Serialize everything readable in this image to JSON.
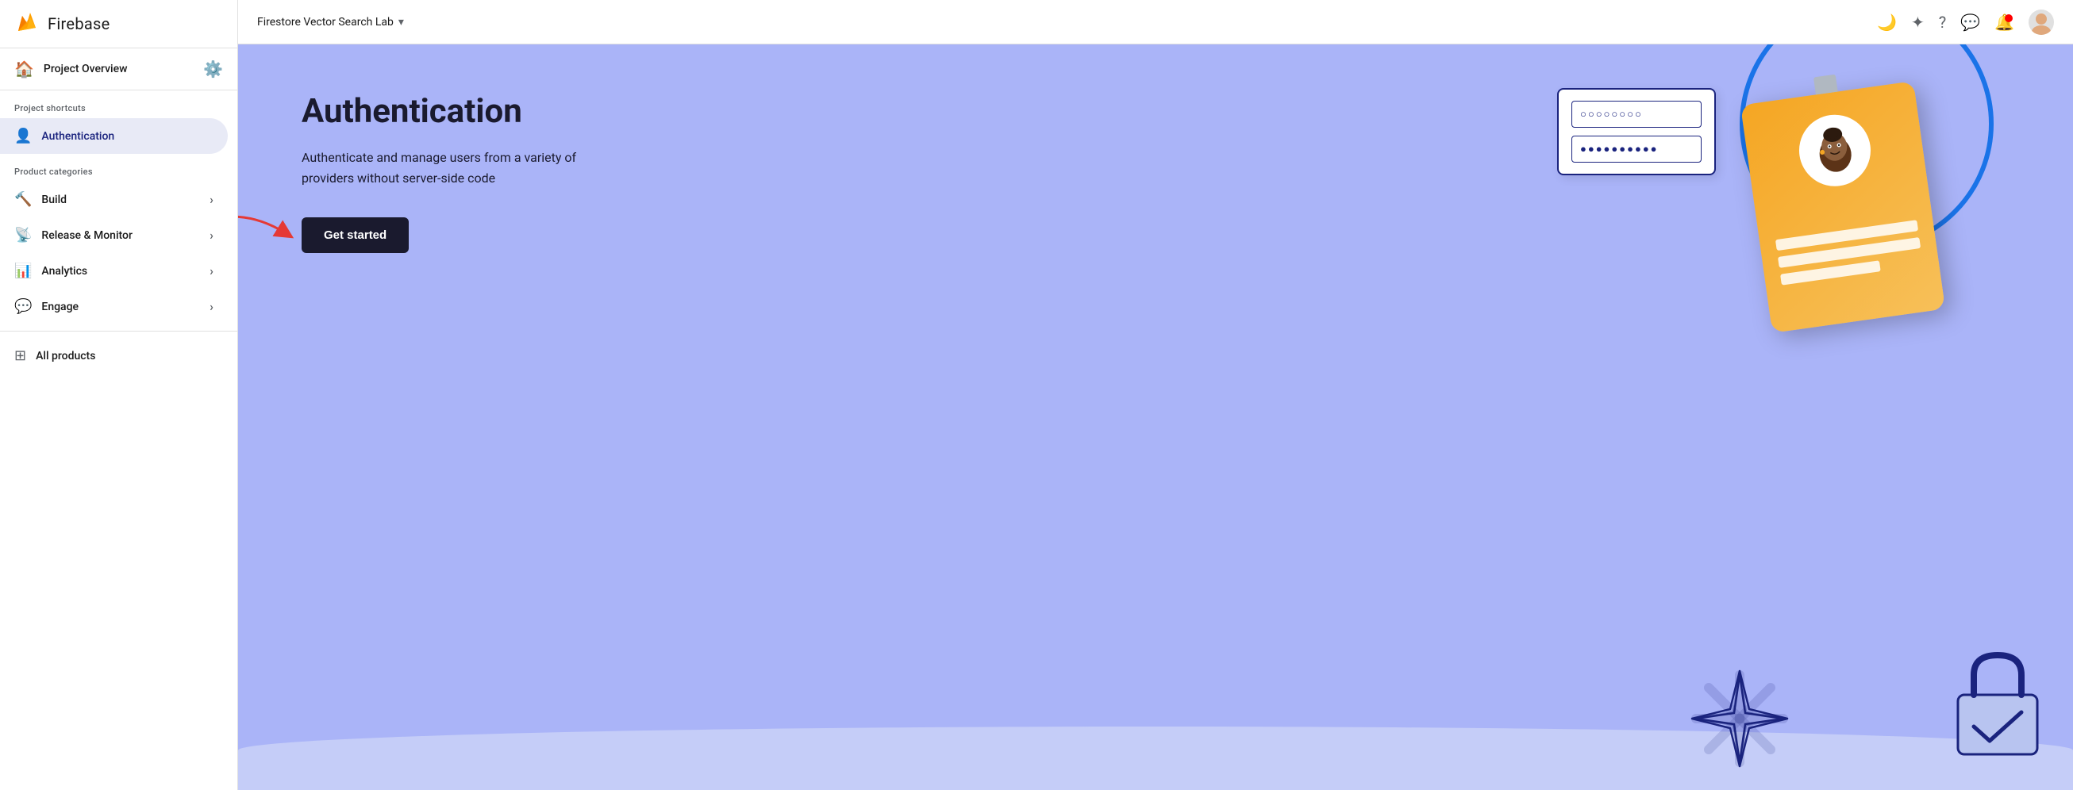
{
  "sidebar": {
    "logo_text": "Firebase",
    "project_overview_label": "Project Overview",
    "project_shortcuts_label": "Project shortcuts",
    "product_categories_label": "Product categories",
    "active_item": {
      "icon": "👤",
      "label": "Authentication"
    },
    "category_items": [
      {
        "label": "Build",
        "icon": "🔨"
      },
      {
        "label": "Release & Monitor",
        "icon": "📡"
      },
      {
        "label": "Analytics",
        "icon": "📊"
      },
      {
        "label": "Engage",
        "icon": "💬"
      }
    ],
    "all_products_label": "All products"
  },
  "topbar": {
    "project_name": "Firestore Vector Search Lab",
    "icons": [
      "moon",
      "sparkle",
      "help",
      "chat",
      "notifications",
      "avatar"
    ]
  },
  "content": {
    "title": "Authentication",
    "description": "Authenticate and manage users from a variety of providers without server-side code",
    "cta_label": "Get started"
  },
  "login_form": {
    "field1": "○○○○○○○○",
    "field2": "●●●●●●●●●●"
  }
}
